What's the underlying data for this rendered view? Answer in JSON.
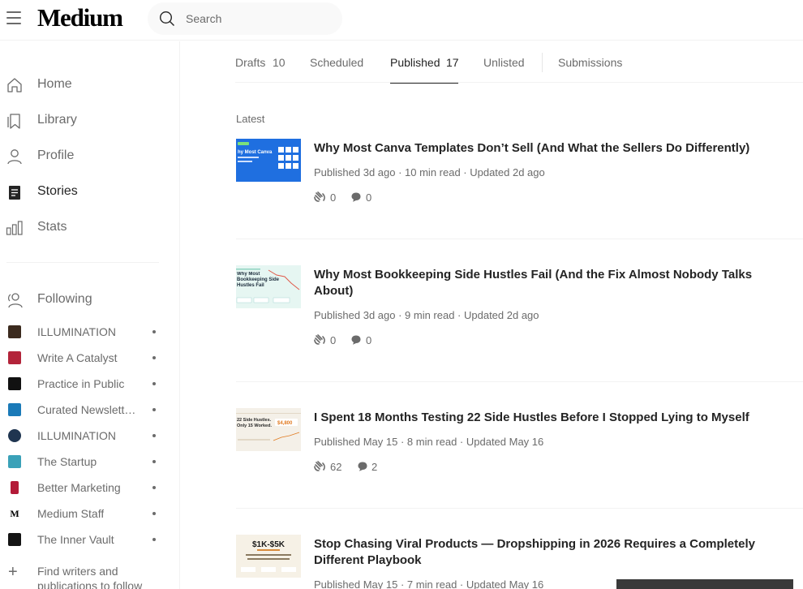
{
  "app": {
    "logo": "Medium"
  },
  "search": {
    "placeholder": "Search"
  },
  "sidebar": {
    "nav": [
      {
        "label": "Home",
        "icon": "home-icon"
      },
      {
        "label": "Library",
        "icon": "bookmark-icon"
      },
      {
        "label": "Profile",
        "icon": "profile-icon"
      },
      {
        "label": "Stories",
        "icon": "stories-icon",
        "active": true
      },
      {
        "label": "Stats",
        "icon": "stats-icon"
      }
    ],
    "following_label": "Following",
    "following": [
      {
        "name": "ILLUMINATION",
        "color": "#3b2a1e"
      },
      {
        "name": "Write A Catalyst",
        "color": "#b3243a"
      },
      {
        "name": "Practice in Public",
        "color": "#111111"
      },
      {
        "name": "Curated Newsletters",
        "color": "#1a7ab8"
      },
      {
        "name": "ILLUMINATION",
        "color": "#1f3550"
      },
      {
        "name": "The Startup",
        "color": "#3aa1b8"
      },
      {
        "name": "Better Marketing",
        "color": "#b31b38"
      },
      {
        "name": "Medium Staff",
        "color": "#000000"
      },
      {
        "name": "The Inner Vault",
        "color": "#141414"
      }
    ],
    "find_writers": "Find writers and publications to follow"
  },
  "tabs": [
    {
      "label": "Drafts",
      "count": "10"
    },
    {
      "label": "Scheduled",
      "count": ""
    },
    {
      "label": "Published",
      "count": "17",
      "active": true
    },
    {
      "label": "Unlisted",
      "count": ""
    },
    {
      "label": "Submissions",
      "count": ""
    }
  ],
  "section_label": "Latest",
  "stories": [
    {
      "title": "Why Most Canva Templates Don’t Sell (And What the Sellers Do Differently)",
      "meta": "Published 3d ago · 10 min read · Updated 2d ago",
      "claps": "0",
      "responses": "0",
      "thumb_text": "hy Most Canva",
      "thumb_bg": "#1f6fe0"
    },
    {
      "title": "Why Most Bookkeeping Side Hustles Fail (And the Fix Almost Nobody Talks About)",
      "meta": "Published 3d ago · 9 min read · Updated 2d ago",
      "claps": "0",
      "responses": "0",
      "thumb_text": "Why Most Bookkeeping Side Hustles Fail",
      "thumb_bg": "#e6f6f2"
    },
    {
      "title": "I Spent 18 Months Testing 22 Side Hustles Before I Stopped Lying to Myself",
      "meta": "Published May 15 · 8 min read · Updated May 16",
      "claps": "62",
      "responses": "2",
      "thumb_text": "22 Side Hustles. Only 15 Worked.",
      "thumb_badge": "$4,800",
      "thumb_bg": "#f4f0e8"
    },
    {
      "title": "Stop Chasing Viral Products — Dropshipping in 2026 Requires a Completely Different Playbook",
      "meta": "Published May 15 · 7 min read · Updated May 16",
      "claps": "",
      "responses": "",
      "thumb_text": "$1K-$5K",
      "thumb_bg": "#f6f1e6"
    }
  ]
}
